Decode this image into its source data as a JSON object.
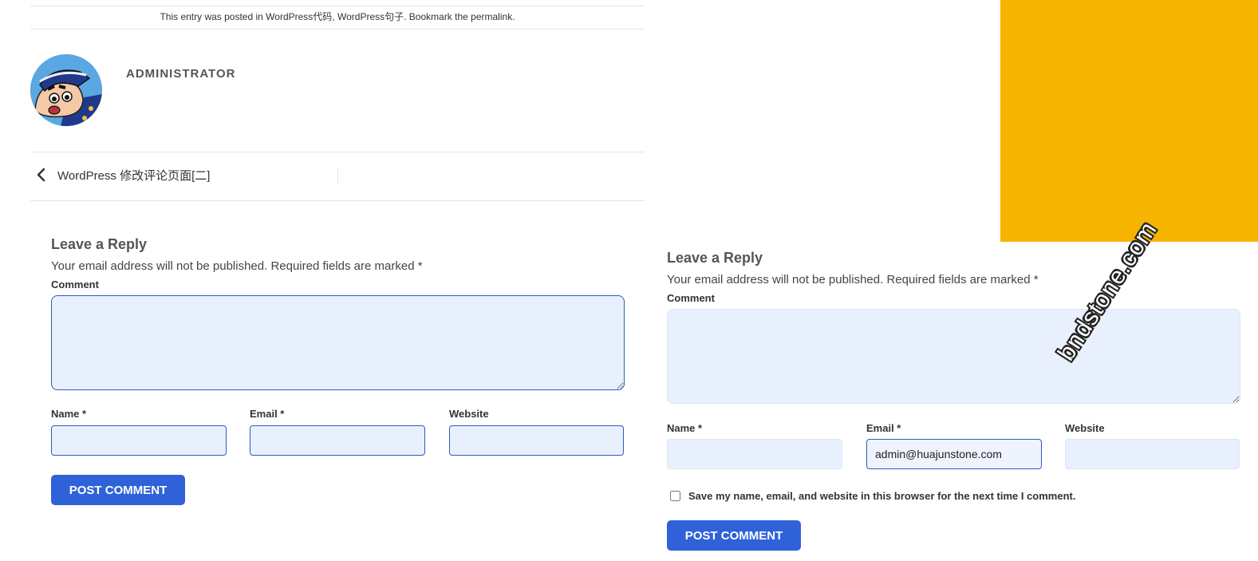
{
  "entry_meta": {
    "prefix": "This entry was posted in ",
    "category_1": "WordPress代码",
    "separator": ", ",
    "category_2": "WordPress句子",
    "middle": ". Bookmark the ",
    "permalink": "permalink",
    "suffix": "."
  },
  "author": {
    "name": "ADMINISTRATOR"
  },
  "post_nav": {
    "previous_title": "WordPress 修改评论页面[二]"
  },
  "left_form": {
    "title": "Leave a Reply",
    "notice": "Your email address will not be published. Required fields are marked *",
    "comment_label": "Comment",
    "name_label": "Name *",
    "email_label": "Email *",
    "website_label": "Website",
    "submit_label": "POST COMMENT"
  },
  "right_form": {
    "title": "Leave a Reply",
    "notice": "Your email address will not be published. Required fields are marked *",
    "comment_label": "Comment",
    "name_label": "Name *",
    "email_label": "Email *",
    "email_value": "admin@huajunstone.com",
    "website_label": "Website",
    "save_label": "Save my name, email, and website in this browser for the next time I comment.",
    "submit_label": "POST COMMENT"
  },
  "watermark": "bndstone.com",
  "colors": {
    "accent_button": "#2f62d9",
    "field_background": "#e8f0fd",
    "yellow_block": "#f6b400"
  },
  "icons": {
    "prev": "chevron-left-icon"
  }
}
